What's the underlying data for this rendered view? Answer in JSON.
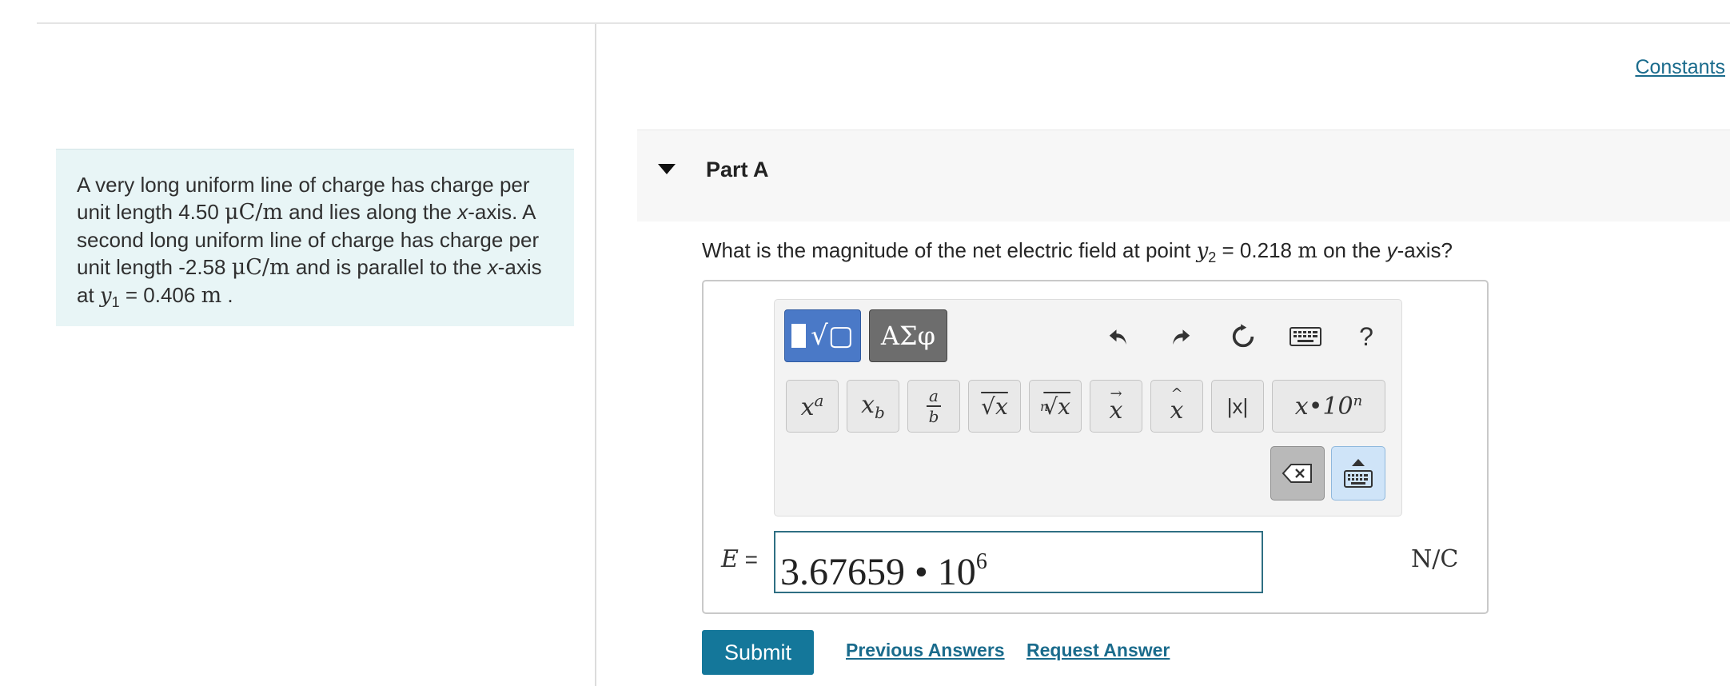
{
  "constants_link": "Constants",
  "intro": {
    "t1": "A very long uniform line of charge has charge per unit length 4.50 ",
    "u1": "μC/m",
    "t2": " and lies along the ",
    "x1": "x",
    "t3": "-axis. A second long uniform line of charge has charge per unit length -2.58 ",
    "u2": "μC/m",
    "t4": " and is parallel to the ",
    "x2": "x",
    "t5": "-axis at ",
    "y1": "y",
    "y1sub": "1",
    "t6": " = 0.406 ",
    "m1": "m",
    "t7": " ."
  },
  "part": {
    "title": "Part A"
  },
  "question": {
    "t1": "What is the magnitude of the net electric field at point ",
    "y": "y",
    "ysub": "2",
    "t2": " = 0.218 ",
    "m": "m",
    "t3": " on the ",
    "axis": "y",
    "t4": "-axis?"
  },
  "toolbar": {
    "templates_icon": "sqrt-template-icon",
    "greek_label": "ΑΣφ",
    "help_label": "?",
    "keys": {
      "power_base": "x",
      "power_exp": "a",
      "sub_base": "x",
      "sub_idx": "b",
      "frac_num": "a",
      "frac_den": "b",
      "sqrt": "√x",
      "nroot_idx": "n",
      "nroot": "√x",
      "vector": "x",
      "hat": "x",
      "abs": "|x|",
      "sci_x": "x",
      "sci_mid": "•10",
      "sci_exp": "n"
    }
  },
  "equation": {
    "var": "E",
    "eq": " ="
  },
  "answer": {
    "mantissa": "3.67659 • 10",
    "exponent": "6"
  },
  "unit": "N/C",
  "actions": {
    "submit": "Submit",
    "previous": "Previous Answers",
    "request": "Request Answer"
  },
  "colors": {
    "accent": "#14779a",
    "link": "#1a6b8c",
    "intro_bg": "#e8f5f6",
    "template_btn": "#4a79c7",
    "greek_btn": "#6d6d6d"
  }
}
